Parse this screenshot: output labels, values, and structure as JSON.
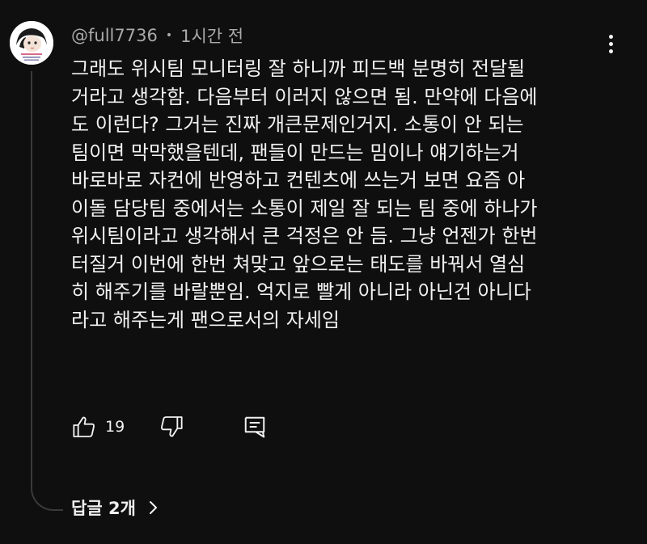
{
  "comment": {
    "author": "@full7736",
    "separator": "•",
    "timestamp": "1시간 전",
    "lines": [
      "그래도 위시팀 모니터링 잘 하니까 피드백 분명히 전달될",
      "거라고 생각함. 다음부터 이러지 않으면 됨. 만약에 다음에",
      "도 이런다? 그거는 진짜 개큰문제인거지. 소통이 안 되는",
      "팀이면 막막했을텐데, 팬들이 만드는 밈이나 얘기하는거",
      "바로바로 자컨에 반영하고 컨텐츠에 쓰는거 보면 요즘 아",
      "이돌 담당팀 중에서는 소통이 제일 잘 되는 팀 중에 하나가",
      "위시팀이라고 생각해서 큰 걱정은 안 듬. 그냥 언젠가 한번",
      "터질거 이번에 한번 쳐맞고 앞으로는 태도를 바꿔서 열심",
      "히 해주기를 바랄뿐임. 억지로 빨게 아니라 아닌건 아니다",
      "라고 해주는게 팬으로서의 자세임"
    ],
    "like_count": "19",
    "replies_label": "답글 2개"
  },
  "icons": {
    "like": "thumbs-up-icon",
    "dislike": "thumbs-down-icon",
    "reply": "reply-comment-icon",
    "menu": "more-vertical-icon",
    "replies_chevron": "chevron-right-icon"
  },
  "colors": {
    "background": "#0f0f0f",
    "text_primary": "#f1f1f1",
    "text_secondary": "#aaaaaa",
    "thread_line": "#3a3a3a"
  }
}
